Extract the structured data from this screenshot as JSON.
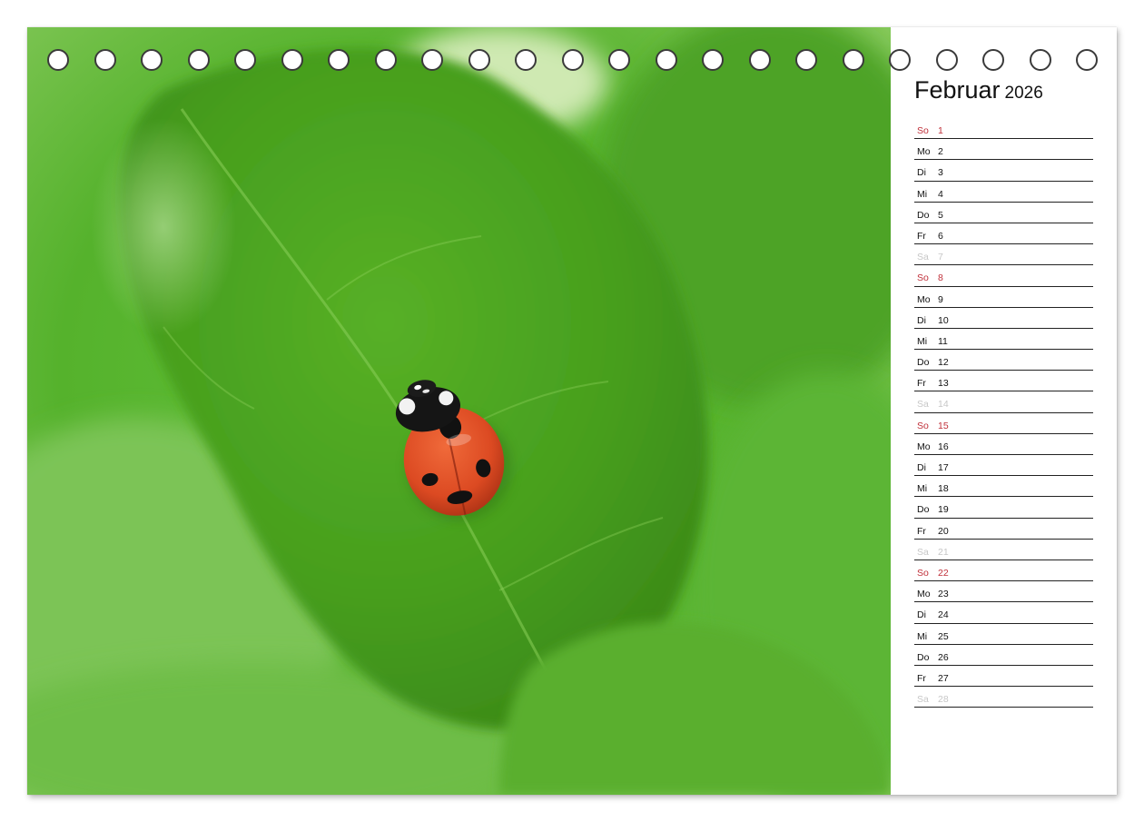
{
  "calendar": {
    "month": "Februar",
    "year": "2026",
    "days": [
      {
        "wd": "So",
        "d": "1",
        "type": "sun"
      },
      {
        "wd": "Mo",
        "d": "2",
        "type": "week"
      },
      {
        "wd": "Di",
        "d": "3",
        "type": "week"
      },
      {
        "wd": "Mi",
        "d": "4",
        "type": "week"
      },
      {
        "wd": "Do",
        "d": "5",
        "type": "week"
      },
      {
        "wd": "Fr",
        "d": "6",
        "type": "week"
      },
      {
        "wd": "Sa",
        "d": "7",
        "type": "sat"
      },
      {
        "wd": "So",
        "d": "8",
        "type": "sun"
      },
      {
        "wd": "Mo",
        "d": "9",
        "type": "week"
      },
      {
        "wd": "Di",
        "d": "10",
        "type": "week"
      },
      {
        "wd": "Mi",
        "d": "11",
        "type": "week"
      },
      {
        "wd": "Do",
        "d": "12",
        "type": "week"
      },
      {
        "wd": "Fr",
        "d": "13",
        "type": "week"
      },
      {
        "wd": "Sa",
        "d": "14",
        "type": "sat"
      },
      {
        "wd": "So",
        "d": "15",
        "type": "sun"
      },
      {
        "wd": "Mo",
        "d": "16",
        "type": "week"
      },
      {
        "wd": "Di",
        "d": "17",
        "type": "week"
      },
      {
        "wd": "Mi",
        "d": "18",
        "type": "week"
      },
      {
        "wd": "Do",
        "d": "19",
        "type": "week"
      },
      {
        "wd": "Fr",
        "d": "20",
        "type": "week"
      },
      {
        "wd": "Sa",
        "d": "21",
        "type": "sat"
      },
      {
        "wd": "So",
        "d": "22",
        "type": "sun"
      },
      {
        "wd": "Mo",
        "d": "23",
        "type": "week"
      },
      {
        "wd": "Di",
        "d": "24",
        "type": "week"
      },
      {
        "wd": "Mi",
        "d": "25",
        "type": "week"
      },
      {
        "wd": "Do",
        "d": "26",
        "type": "week"
      },
      {
        "wd": "Fr",
        "d": "27",
        "type": "week"
      },
      {
        "wd": "Sa",
        "d": "28",
        "type": "sat"
      }
    ]
  },
  "colors": {
    "sunday": "#c0303a",
    "saturday": "#c7c7c7",
    "leaf": "#4fae22"
  },
  "icons": {
    "binding_holes": "ring-hole-icon"
  }
}
